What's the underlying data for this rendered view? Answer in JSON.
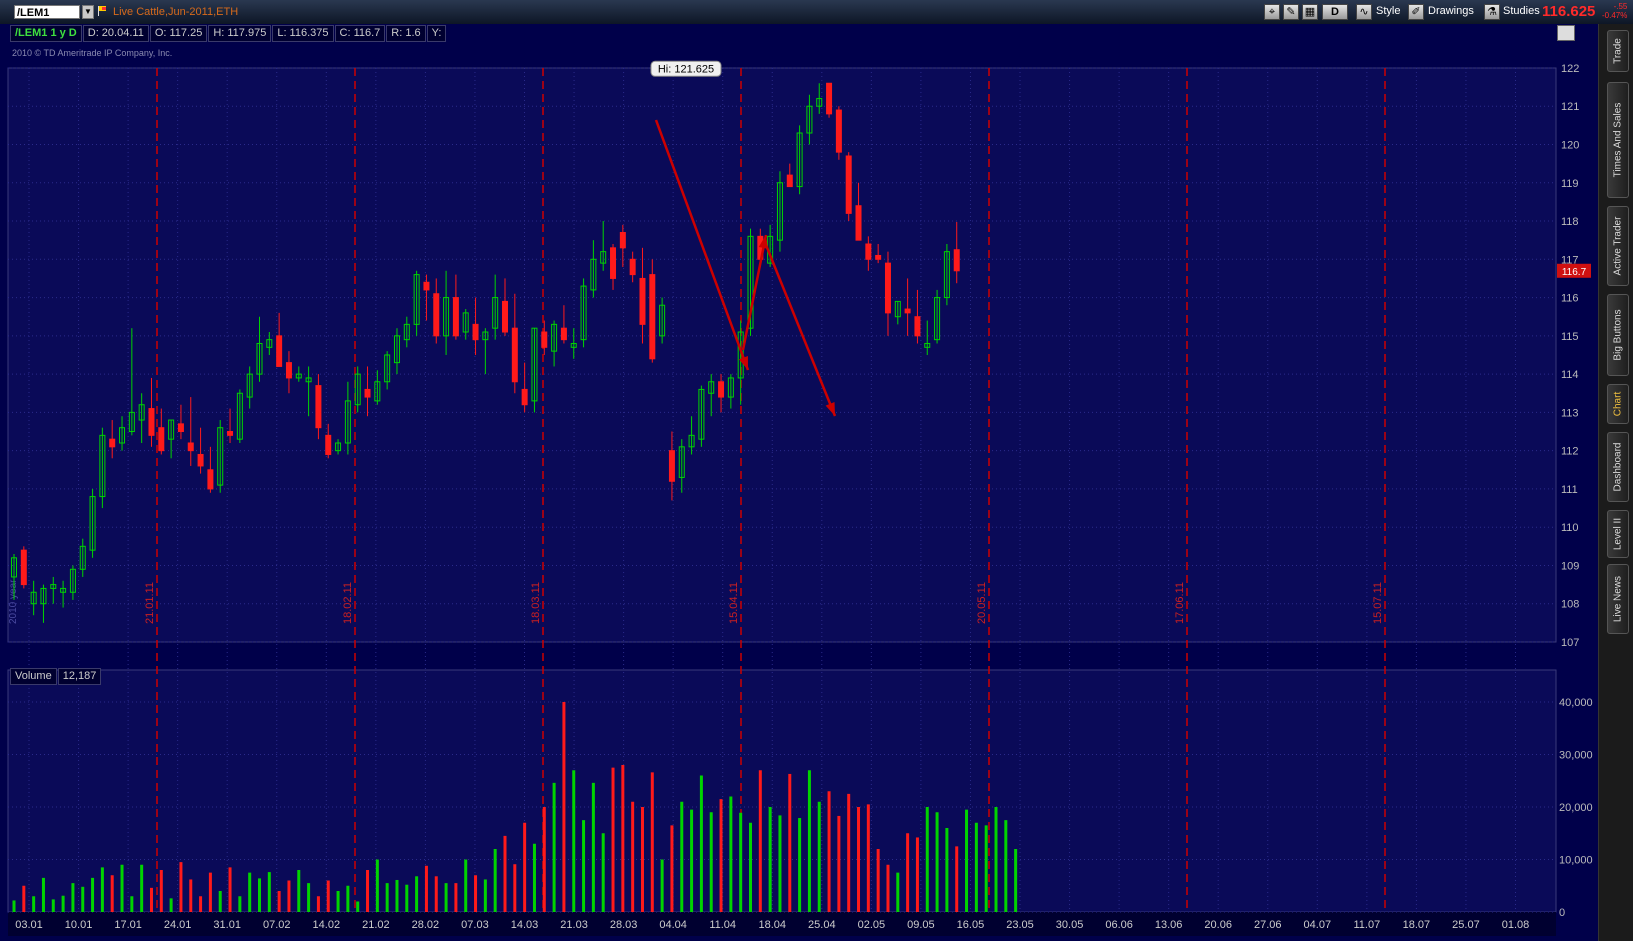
{
  "toolbar": {
    "symbol": "/LEM1",
    "instrument": "Live Cattle,Jun-2011,ETH",
    "period_button": "D",
    "style_label": "Style",
    "drawings_label": "Drawings",
    "studies_label": "Studies",
    "last_price": "116.625",
    "change_abs": "-.55",
    "change_pct": "-0.47%"
  },
  "infobar": {
    "symbol_period": "/LEM1 1 y D",
    "date": "D: 20.04.11",
    "open": "O: 117.25",
    "high": "H: 117.975",
    "low": "L: 116.375",
    "close": "C: 116.7",
    "range": "R: 1.6",
    "y": "Y:"
  },
  "copyright": "2010 © TD Ameritrade IP Company, Inc.",
  "volume_panel": {
    "label": "Volume",
    "value": "12,187"
  },
  "hi_label": "Hi: 121.625",
  "price_marker": "116.7",
  "year_label": "2010 year",
  "sidebar_tabs": [
    "Trade",
    "Times And Sales",
    "Active Trader",
    "Big Buttons",
    "Chart",
    "Dashboard",
    "Level II",
    "Live News"
  ],
  "colors": {
    "up": "#00d400",
    "down": "#ff1a1a",
    "bg": "#00004a",
    "grid": "#2a2a8a",
    "marker": "#cc0000"
  },
  "chart_data": {
    "type": "candlestick",
    "price_axis": {
      "min": 107,
      "max": 122,
      "ticks": [
        122,
        121,
        120,
        119,
        118,
        117,
        116,
        115,
        114,
        113,
        112,
        111,
        110,
        109,
        108,
        107
      ]
    },
    "volume_axis": {
      "min": 0,
      "max": 40000,
      "tick_labels": [
        "40,000",
        "30,000",
        "20,000",
        "10,000",
        "0"
      ]
    },
    "x_tick_labels": [
      "03.01",
      "10.01",
      "17.01",
      "24.01",
      "31.01",
      "07.02",
      "14.02",
      "21.02",
      "28.02",
      "07.03",
      "14.03",
      "21.03",
      "28.03",
      "04.04",
      "11.04",
      "18.04",
      "25.04",
      "02.05",
      "09.05",
      "16.05",
      "23.05",
      "30.05",
      "06.06",
      "13.06",
      "20.06",
      "27.06",
      "04.07",
      "11.07",
      "18.07",
      "25.07",
      "01.08"
    ],
    "vertical_markers": [
      "21.01.11",
      "18.02.11",
      "18.03.11",
      "15.04.11",
      "20.05.11",
      "17.06.11",
      "15.07.11"
    ],
    "candles": [
      {
        "o": 108.7,
        "h": 109.3,
        "l": 108.1,
        "c": 109.2
      },
      {
        "o": 109.4,
        "h": 109.5,
        "l": 108.4,
        "c": 108.5
      },
      {
        "o": 108.0,
        "h": 108.6,
        "l": 107.7,
        "c": 108.3
      },
      {
        "o": 108.0,
        "h": 108.5,
        "l": 107.5,
        "c": 108.4
      },
      {
        "o": 108.4,
        "h": 108.7,
        "l": 108.0,
        "c": 108.5
      },
      {
        "o": 108.3,
        "h": 108.6,
        "l": 107.9,
        "c": 108.4
      },
      {
        "o": 108.3,
        "h": 109.0,
        "l": 108.1,
        "c": 108.9
      },
      {
        "o": 108.9,
        "h": 109.7,
        "l": 108.7,
        "c": 109.5
      },
      {
        "o": 109.4,
        "h": 111.0,
        "l": 109.2,
        "c": 110.8
      },
      {
        "o": 110.8,
        "h": 112.6,
        "l": 110.5,
        "c": 112.4
      },
      {
        "o": 112.3,
        "h": 112.8,
        "l": 111.8,
        "c": 112.1
      },
      {
        "o": 112.2,
        "h": 112.9,
        "l": 112.0,
        "c": 112.6
      },
      {
        "o": 112.5,
        "h": 115.2,
        "l": 112.4,
        "c": 113.0
      },
      {
        "o": 112.8,
        "h": 113.5,
        "l": 112.2,
        "c": 113.2
      },
      {
        "o": 113.1,
        "h": 113.9,
        "l": 112.1,
        "c": 112.4
      },
      {
        "o": 112.6,
        "h": 113.1,
        "l": 111.9,
        "c": 112.0
      },
      {
        "o": 112.3,
        "h": 112.8,
        "l": 111.8,
        "c": 112.8
      },
      {
        "o": 112.7,
        "h": 113.2,
        "l": 112.3,
        "c": 112.5
      },
      {
        "o": 112.2,
        "h": 113.4,
        "l": 111.6,
        "c": 112.0
      },
      {
        "o": 111.9,
        "h": 112.6,
        "l": 111.4,
        "c": 111.6
      },
      {
        "o": 111.5,
        "h": 112.1,
        "l": 110.9,
        "c": 111.0
      },
      {
        "o": 111.1,
        "h": 112.8,
        "l": 110.9,
        "c": 112.6
      },
      {
        "o": 112.5,
        "h": 113.1,
        "l": 112.2,
        "c": 112.4
      },
      {
        "o": 112.3,
        "h": 113.6,
        "l": 112.2,
        "c": 113.5
      },
      {
        "o": 113.4,
        "h": 114.2,
        "l": 113.1,
        "c": 114.0
      },
      {
        "o": 114.0,
        "h": 115.5,
        "l": 113.8,
        "c": 114.8
      },
      {
        "o": 114.7,
        "h": 115.1,
        "l": 114.5,
        "c": 114.9
      },
      {
        "o": 115.0,
        "h": 115.6,
        "l": 114.2,
        "c": 114.2
      },
      {
        "o": 114.3,
        "h": 114.6,
        "l": 113.5,
        "c": 113.9
      },
      {
        "o": 113.9,
        "h": 114.2,
        "l": 113.8,
        "c": 114.0
      },
      {
        "o": 113.8,
        "h": 114.2,
        "l": 112.9,
        "c": 113.9
      },
      {
        "o": 113.7,
        "h": 114.0,
        "l": 112.3,
        "c": 112.6
      },
      {
        "o": 112.4,
        "h": 112.7,
        "l": 111.8,
        "c": 111.9
      },
      {
        "o": 112.0,
        "h": 112.3,
        "l": 111.9,
        "c": 112.2
      },
      {
        "o": 112.2,
        "h": 113.8,
        "l": 111.9,
        "c": 113.3
      },
      {
        "o": 113.2,
        "h": 114.2,
        "l": 113.0,
        "c": 114.0
      },
      {
        "o": 113.6,
        "h": 114.2,
        "l": 112.9,
        "c": 113.4
      },
      {
        "o": 113.3,
        "h": 114.1,
        "l": 113.2,
        "c": 113.8
      },
      {
        "o": 113.8,
        "h": 114.6,
        "l": 113.6,
        "c": 114.5
      },
      {
        "o": 114.3,
        "h": 115.2,
        "l": 114.0,
        "c": 115.0
      },
      {
        "o": 114.9,
        "h": 115.5,
        "l": 114.7,
        "c": 115.3
      },
      {
        "o": 115.3,
        "h": 116.7,
        "l": 115.0,
        "c": 116.6
      },
      {
        "o": 116.4,
        "h": 116.6,
        "l": 115.4,
        "c": 116.2
      },
      {
        "o": 116.1,
        "h": 116.5,
        "l": 114.8,
        "c": 115.0
      },
      {
        "o": 115.0,
        "h": 116.7,
        "l": 114.5,
        "c": 116.0
      },
      {
        "o": 116.0,
        "h": 116.6,
        "l": 114.9,
        "c": 115.0
      },
      {
        "o": 115.1,
        "h": 115.7,
        "l": 114.9,
        "c": 115.6
      },
      {
        "o": 115.3,
        "h": 116.0,
        "l": 114.5,
        "c": 114.9
      },
      {
        "o": 114.9,
        "h": 115.2,
        "l": 114.0,
        "c": 115.1
      },
      {
        "o": 115.2,
        "h": 116.6,
        "l": 114.9,
        "c": 116.0
      },
      {
        "o": 115.9,
        "h": 116.5,
        "l": 115.0,
        "c": 115.1
      },
      {
        "o": 115.2,
        "h": 116.1,
        "l": 113.5,
        "c": 113.8
      },
      {
        "o": 113.6,
        "h": 114.3,
        "l": 113.0,
        "c": 113.2
      },
      {
        "o": 113.3,
        "h": 115.2,
        "l": 113.0,
        "c": 115.2
      },
      {
        "o": 115.1,
        "h": 115.4,
        "l": 114.5,
        "c": 114.7
      },
      {
        "o": 114.6,
        "h": 115.4,
        "l": 114.2,
        "c": 115.3
      },
      {
        "o": 115.2,
        "h": 115.8,
        "l": 114.8,
        "c": 114.9
      },
      {
        "o": 114.7,
        "h": 115.2,
        "l": 114.4,
        "c": 114.8
      },
      {
        "o": 114.9,
        "h": 116.5,
        "l": 114.7,
        "c": 116.3
      },
      {
        "o": 116.2,
        "h": 117.5,
        "l": 116.0,
        "c": 117.0
      },
      {
        "o": 116.9,
        "h": 118.0,
        "l": 116.7,
        "c": 117.2
      },
      {
        "o": 117.3,
        "h": 117.4,
        "l": 116.2,
        "c": 116.5
      },
      {
        "o": 117.7,
        "h": 117.9,
        "l": 116.8,
        "c": 117.3
      },
      {
        "o": 117.0,
        "h": 117.2,
        "l": 116.4,
        "c": 116.6
      },
      {
        "o": 116.5,
        "h": 117.3,
        "l": 114.8,
        "c": 115.3
      },
      {
        "o": 116.6,
        "h": 117.0,
        "l": 114.3,
        "c": 114.4
      },
      {
        "o": 115.0,
        "h": 116.0,
        "l": 114.8,
        "c": 115.8
      },
      {
        "o": 112.0,
        "h": 112.5,
        "l": 110.7,
        "c": 111.2
      },
      {
        "o": 111.3,
        "h": 112.3,
        "l": 110.9,
        "c": 112.1
      },
      {
        "o": 112.1,
        "h": 112.9,
        "l": 111.9,
        "c": 112.4
      },
      {
        "o": 112.3,
        "h": 113.7,
        "l": 112.1,
        "c": 113.6
      },
      {
        "o": 113.5,
        "h": 114.0,
        "l": 112.9,
        "c": 113.8
      },
      {
        "o": 113.8,
        "h": 114.0,
        "l": 113.0,
        "c": 113.4
      },
      {
        "o": 113.4,
        "h": 114.0,
        "l": 113.1,
        "c": 113.9
      },
      {
        "o": 113.9,
        "h": 115.4,
        "l": 113.2,
        "c": 115.1
      },
      {
        "o": 115.2,
        "h": 117.8,
        "l": 115.0,
        "c": 117.6
      },
      {
        "o": 117.6,
        "h": 117.8,
        "l": 116.8,
        "c": 117.0
      },
      {
        "o": 116.9,
        "h": 117.9,
        "l": 116.8,
        "c": 117.6
      },
      {
        "o": 117.5,
        "h": 119.3,
        "l": 117.2,
        "c": 119.0
      },
      {
        "o": 119.2,
        "h": 119.5,
        "l": 118.9,
        "c": 118.9
      },
      {
        "o": 118.9,
        "h": 120.5,
        "l": 118.7,
        "c": 120.3
      },
      {
        "o": 120.3,
        "h": 121.3,
        "l": 120.0,
        "c": 121.0
      },
      {
        "o": 121.0,
        "h": 121.6,
        "l": 120.8,
        "c": 121.2
      },
      {
        "o": 121.6,
        "h": 121.6,
        "l": 120.7,
        "c": 120.8
      },
      {
        "o": 120.9,
        "h": 121.0,
        "l": 119.6,
        "c": 119.8
      },
      {
        "o": 119.7,
        "h": 119.8,
        "l": 118.0,
        "c": 118.2
      },
      {
        "o": 118.4,
        "h": 119.0,
        "l": 117.6,
        "c": 117.5
      },
      {
        "o": 117.4,
        "h": 117.6,
        "l": 116.7,
        "c": 117.0
      },
      {
        "o": 117.1,
        "h": 117.4,
        "l": 116.9,
        "c": 117.0
      },
      {
        "o": 116.9,
        "h": 117.2,
        "l": 115.0,
        "c": 115.6
      },
      {
        "o": 115.5,
        "h": 115.9,
        "l": 115.3,
        "c": 115.9
      },
      {
        "o": 115.7,
        "h": 116.5,
        "l": 115.0,
        "c": 115.6
      },
      {
        "o": 115.5,
        "h": 116.2,
        "l": 114.8,
        "c": 115.0
      },
      {
        "o": 114.7,
        "h": 115.4,
        "l": 114.5,
        "c": 114.8
      },
      {
        "o": 114.9,
        "h": 116.2,
        "l": 114.8,
        "c": 116.0
      },
      {
        "o": 116.0,
        "h": 117.4,
        "l": 115.8,
        "c": 117.2
      },
      {
        "o": 117.25,
        "h": 117.975,
        "l": 116.375,
        "c": 116.7
      }
    ],
    "volumes": [
      2200,
      5000,
      3000,
      6500,
      2400,
      3100,
      5500,
      4800,
      6500,
      8500,
      7000,
      9000,
      3000,
      9000,
      4600,
      8000,
      2600,
      9500,
      6200,
      3000,
      7500,
      4000,
      8500,
      3000,
      7500,
      6400,
      7600,
      4000,
      6000,
      8000,
      5500,
      3000,
      6000,
      4000,
      5000,
      2000,
      8000,
      10000,
      5500,
      6100,
      5200,
      6800,
      8800,
      6800,
      5500,
      5500,
      10000,
      7000,
      6200,
      12000,
      14500,
      9100,
      17000,
      13000,
      20000,
      24600,
      40000,
      27000,
      17500,
      24600,
      15000,
      27500,
      28000,
      21000,
      20000,
      26600,
      10000,
      16500,
      21000,
      19500,
      26000,
      19000,
      21500,
      22000,
      18900,
      17000,
      27000,
      20000,
      18400,
      26300,
      17900,
      27000,
      21000,
      23000,
      18300,
      22500,
      20000,
      20500,
      12000,
      9000,
      7500,
      15000,
      14200,
      20000,
      19000,
      16000,
      12500,
      19500,
      17000,
      16500,
      20000,
      17500,
      12000
    ]
  }
}
